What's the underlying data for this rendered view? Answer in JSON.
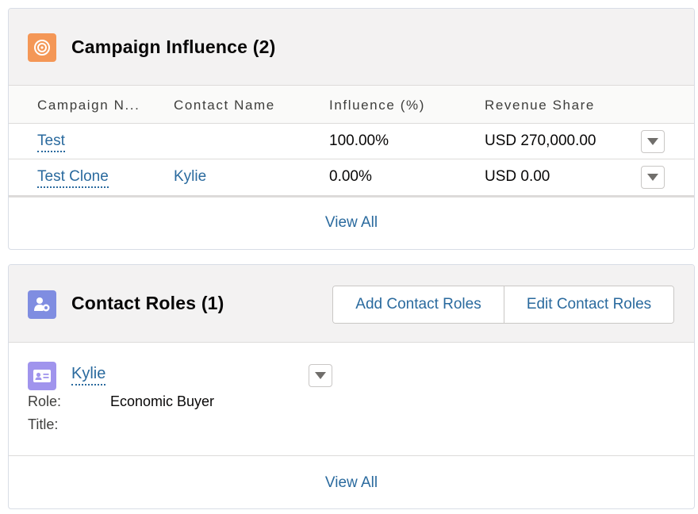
{
  "campaign_influence": {
    "title": "Campaign Influence (2)",
    "icon": "target-icon",
    "icon_color": "#f49756",
    "columns": [
      "Campaign N...",
      "Contact Name",
      "Influence (%)",
      "Revenue Share"
    ],
    "rows": [
      {
        "campaign": "Test",
        "contact": "",
        "influence": "100.00%",
        "revenue": "USD 270,000.00"
      },
      {
        "campaign": "Test Clone",
        "contact": "Kylie",
        "influence": "0.00%",
        "revenue": "USD 0.00"
      }
    ],
    "view_all": "View All"
  },
  "contact_roles": {
    "title": "Contact Roles (1)",
    "icon": "contact-role-icon",
    "icon_color": "#7f8de1",
    "add_button": "Add Contact Roles",
    "edit_button": "Edit Contact Roles",
    "contact": {
      "name": "Kylie",
      "icon": "contact-card-icon",
      "role_label": "Role:",
      "role_value": "Economic Buyer",
      "title_label": "Title:",
      "title_value": ""
    },
    "view_all": "View All"
  },
  "colors": {
    "link": "#2a6a9e",
    "header_bg": "#f3f2f2",
    "border": "#d8dde6"
  }
}
